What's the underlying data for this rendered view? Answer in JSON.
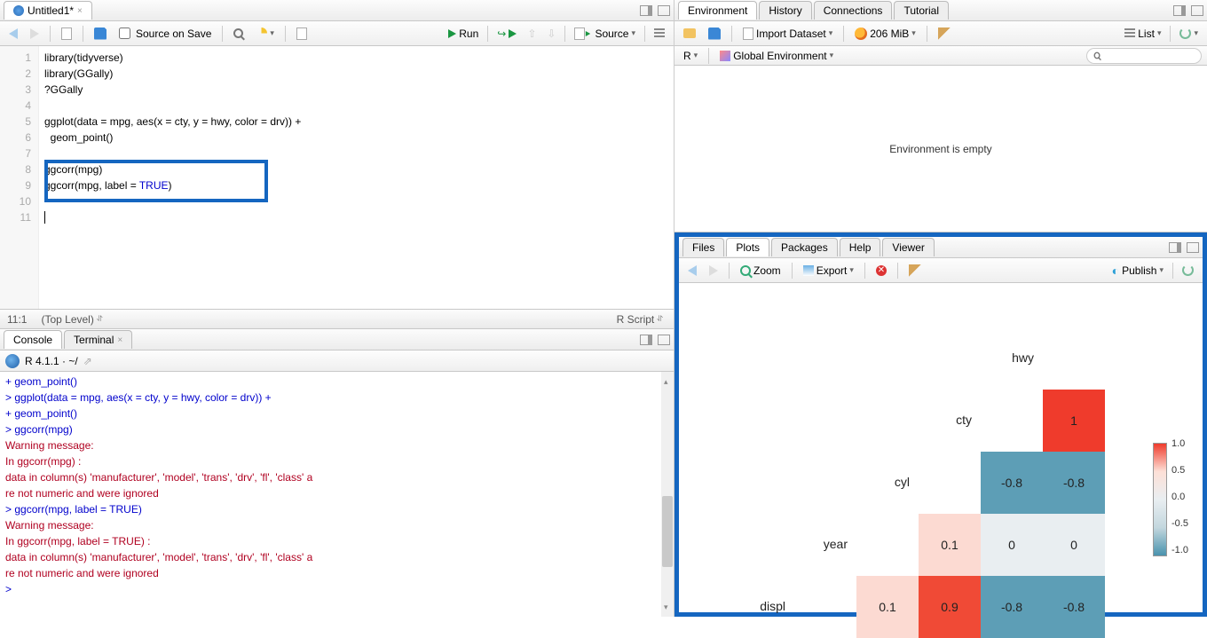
{
  "source": {
    "tab_title": "Untitled1*",
    "toolbar": {
      "source_on_save": "Source on Save",
      "run": "Run",
      "source_btn": "Source",
      "checkbox_checked": false
    },
    "lines": [
      "library(tidyverse)",
      "library(GGally)",
      "?GGally",
      "",
      "ggplot(data = mpg, aes(x = cty, y = hwy, color = drv)) +",
      "  geom_point()",
      "",
      "ggcorr(mpg)",
      "ggcorr(mpg, label = TRUE)",
      "",
      ""
    ],
    "cursor": "11:1",
    "scope": "(Top Level)",
    "ftype": "R Script"
  },
  "console": {
    "tabs": [
      "Console",
      "Terminal"
    ],
    "banner": "R 4.1.1 · ~/",
    "lines": [
      {
        "cls": "con-plus",
        "t": "+   geom_point()"
      },
      {
        "cls": "con-blue",
        "t": "> ggplot(data = mpg, aes(x = cty, y = hwy, color = drv)) +"
      },
      {
        "cls": "con-plus",
        "t": "+   geom_point()"
      },
      {
        "cls": "con-blue",
        "t": "> ggcorr(mpg)"
      },
      {
        "cls": "con-red",
        "t": "Warning message:"
      },
      {
        "cls": "con-red",
        "t": "In ggcorr(mpg) :"
      },
      {
        "cls": "con-red",
        "t": "  data in column(s) 'manufacturer', 'model', 'trans', 'drv', 'fl', 'class' a"
      },
      {
        "cls": "con-red",
        "t": "re not numeric and were ignored"
      },
      {
        "cls": "con-blue",
        "t": "> ggcorr(mpg, label = TRUE)"
      },
      {
        "cls": "con-red",
        "t": "Warning message:"
      },
      {
        "cls": "con-red",
        "t": "In ggcorr(mpg, label = TRUE) :"
      },
      {
        "cls": "con-red",
        "t": "  data in column(s) 'manufacturer', 'model', 'trans', 'drv', 'fl', 'class' a"
      },
      {
        "cls": "con-red",
        "t": "re not numeric and were ignored"
      },
      {
        "cls": "con-blue",
        "t": "> "
      }
    ]
  },
  "env": {
    "tabs": [
      "Environment",
      "History",
      "Connections",
      "Tutorial"
    ],
    "import": "Import Dataset",
    "mem": "206 MiB",
    "view": "List",
    "scope_r": "R",
    "scope_env": "Global Environment",
    "empty_msg": "Environment is empty"
  },
  "plots": {
    "tabs": [
      "Files",
      "Plots",
      "Packages",
      "Help",
      "Viewer"
    ],
    "zoom": "Zoom",
    "export": "Export",
    "publish": "Publish"
  },
  "chart_data": {
    "type": "heatmap",
    "title": "",
    "vars": [
      "displ",
      "year",
      "cyl",
      "cty",
      "hwy"
    ],
    "matrix_upper": {
      "displ": {
        "year": 0.1,
        "cyl": 0.9,
        "cty": -0.8,
        "hwy": -0.8
      },
      "year": {
        "cyl": 0.1,
        "cty": 0,
        "hwy": 0
      },
      "cyl": {
        "cty": -0.8,
        "hwy": -0.8
      },
      "cty": {
        "hwy": 1
      }
    },
    "legend_range": [
      -1.0,
      1.0
    ],
    "legend_ticks": [
      1.0,
      0.5,
      0.0,
      -0.5,
      -1.0
    ],
    "colorscale": {
      "-1": "#4a93ae",
      "-0.8": "#5d9eb6",
      "0": "#e9eef1",
      "0.1": "#fcdad2",
      "0.9": "#f04a36",
      "1": "#ef3b2c"
    }
  }
}
